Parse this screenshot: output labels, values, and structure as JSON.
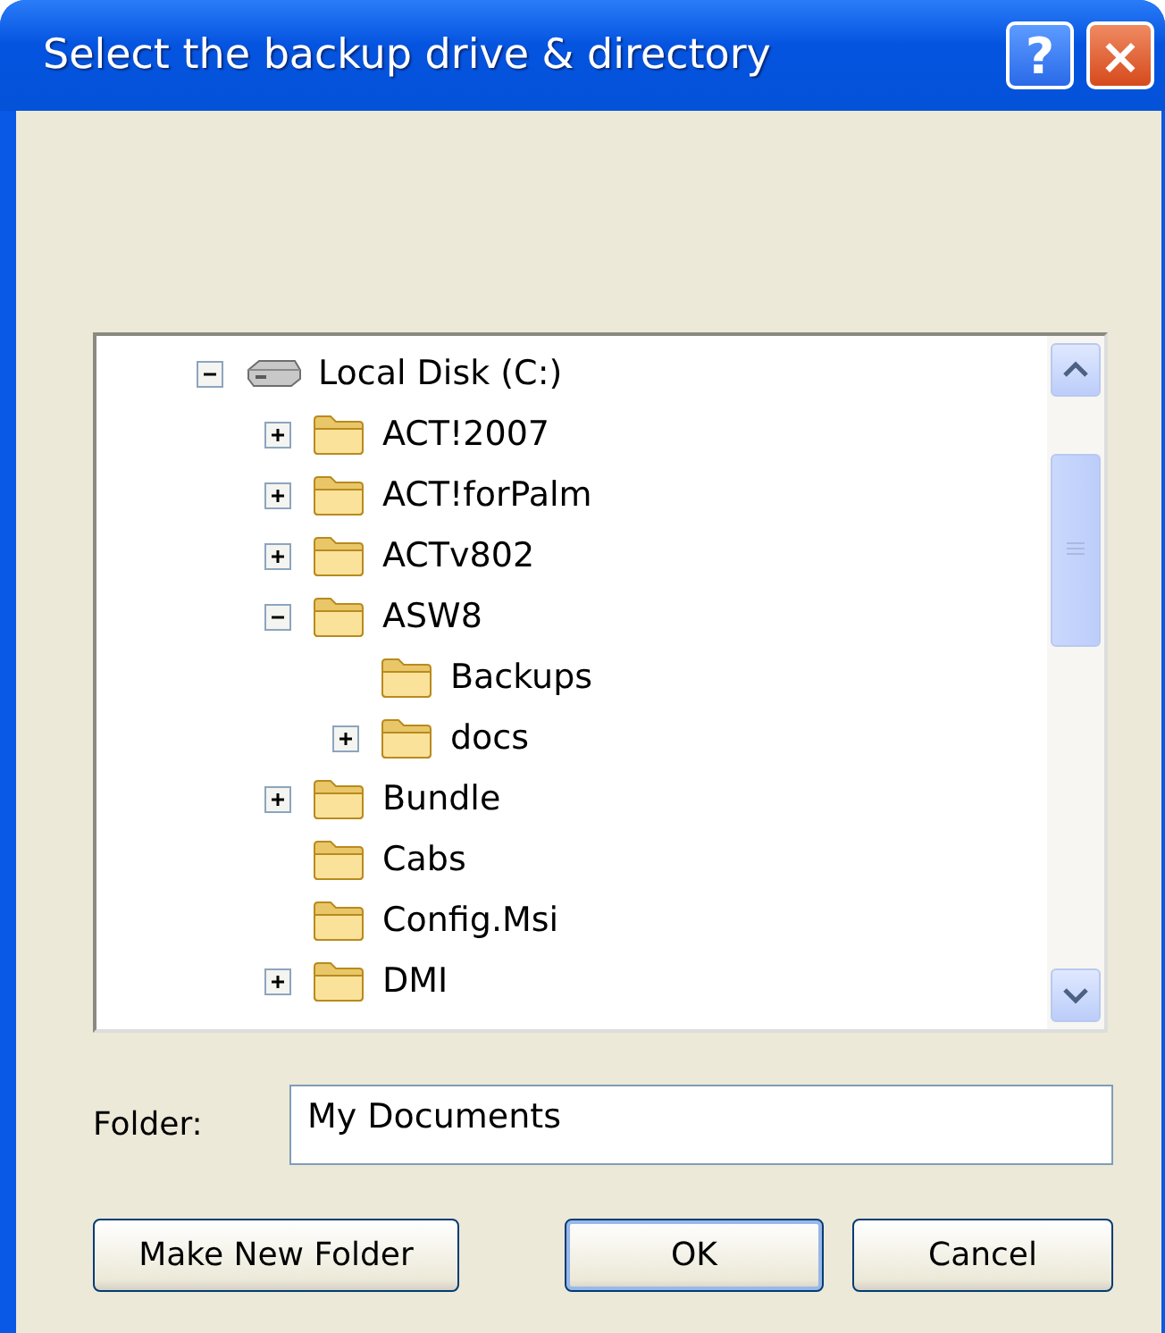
{
  "window": {
    "title": "Select the backup drive & directory",
    "help_button": "?",
    "close_button": "×"
  },
  "tree": [
    {
      "label": "Local Disk (C:)",
      "kind": "drive",
      "expanded": true,
      "children": [
        {
          "label": "ACT!2007",
          "kind": "folder",
          "expanded": false
        },
        {
          "label": "ACT!forPalm",
          "kind": "folder",
          "expanded": false
        },
        {
          "label": "ACTv802",
          "kind": "folder",
          "expanded": false
        },
        {
          "label": "ASW8",
          "kind": "folder",
          "expanded": true,
          "children": [
            {
              "label": "Backups",
              "kind": "folder"
            },
            {
              "label": "docs",
              "kind": "folder",
              "expanded": false
            }
          ]
        },
        {
          "label": "Bundle",
          "kind": "folder",
          "expanded": false
        },
        {
          "label": "Cabs",
          "kind": "folder"
        },
        {
          "label": "Config.Msi",
          "kind": "folder"
        },
        {
          "label": "DMI",
          "kind": "folder",
          "expanded": false
        }
      ]
    }
  ],
  "folder_field": {
    "label": "Folder:",
    "value": "My Documents"
  },
  "buttons": [
    {
      "label": "Make New Folder",
      "default": false
    },
    {
      "label": "OK",
      "default": true
    },
    {
      "label": "Cancel",
      "default": false
    }
  ]
}
